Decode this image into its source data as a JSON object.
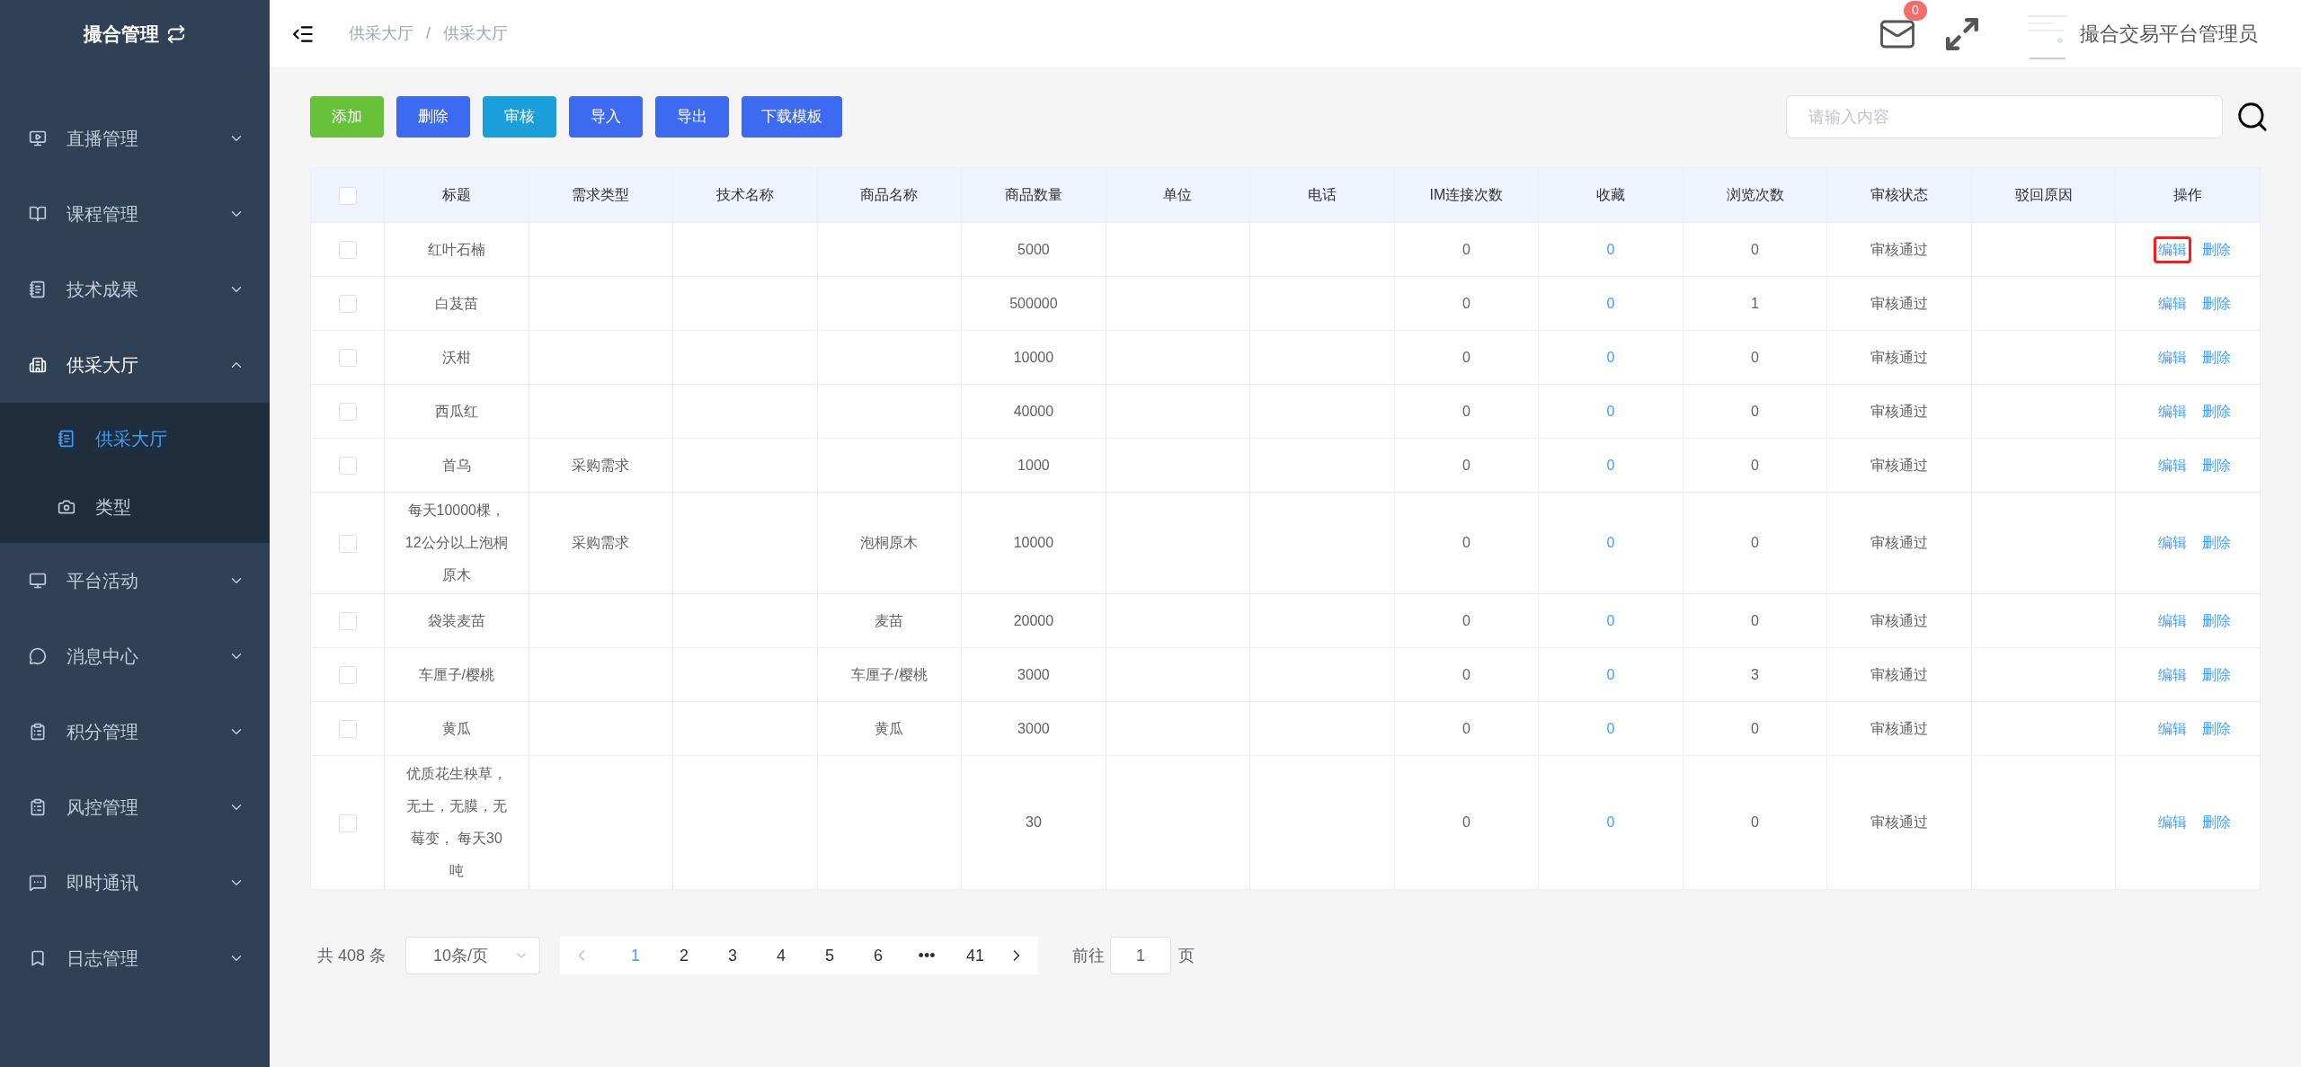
{
  "sidebar": {
    "title": "撮合管理",
    "items": [
      {
        "label": "直播管理",
        "expanded": false
      },
      {
        "label": "课程管理",
        "expanded": false
      },
      {
        "label": "技术成果",
        "expanded": false
      },
      {
        "label": "供采大厅",
        "expanded": true,
        "children": [
          {
            "label": "供采大厅",
            "selected": true
          },
          {
            "label": "类型",
            "selected": false
          }
        ]
      },
      {
        "label": "平台活动",
        "expanded": false
      },
      {
        "label": "消息中心",
        "expanded": false
      },
      {
        "label": "积分管理",
        "expanded": false
      },
      {
        "label": "风控管理",
        "expanded": false
      },
      {
        "label": "即时通讯",
        "expanded": false
      },
      {
        "label": "日志管理",
        "expanded": false
      }
    ]
  },
  "header": {
    "breadcrumb": [
      "供采大厅",
      "供采大厅"
    ],
    "breadcrumb_separator": "/",
    "message_count": "0",
    "user_name": "撮合交易平台管理员"
  },
  "toolbar": {
    "buttons": [
      {
        "label": "添加",
        "kind": "success"
      },
      {
        "label": "删除",
        "kind": "primary"
      },
      {
        "label": "审核",
        "kind": "info"
      },
      {
        "label": "导入",
        "kind": "primary"
      },
      {
        "label": "导出",
        "kind": "primary"
      },
      {
        "label": "下载模板",
        "kind": "primary"
      }
    ],
    "search": {
      "placeholder": "请输入内容"
    }
  },
  "table": {
    "select_all_checked": false,
    "columns": [
      "标题",
      "需求类型",
      "技术名称",
      "商品名称",
      "商品数量",
      "单位",
      "电话",
      "IM连接次数",
      "收藏",
      "浏览次数",
      "审核状态",
      "驳回原因",
      "操作"
    ],
    "rows": [
      {
        "checked": false,
        "title": "红叶石楠",
        "quantity": "5000",
        "im_count": "0",
        "favorites": "0",
        "views": "0",
        "audit_status": "审核通过",
        "edit": "编辑",
        "delete": "删除",
        "highlighted": true
      },
      {
        "checked": false,
        "title": "白芨苗",
        "quantity": "500000",
        "im_count": "0",
        "favorites": "0",
        "views": "1",
        "audit_status": "审核通过",
        "edit": "编辑",
        "delete": "删除",
        "highlighted": false
      },
      {
        "checked": false,
        "title": "沃柑",
        "quantity": "10000",
        "im_count": "0",
        "favorites": "0",
        "views": "0",
        "audit_status": "审核通过",
        "edit": "编辑",
        "delete": "删除",
        "highlighted": false
      },
      {
        "checked": false,
        "title": "西瓜红",
        "quantity": "40000",
        "im_count": "0",
        "favorites": "0",
        "views": "0",
        "audit_status": "审核通过",
        "edit": "编辑",
        "delete": "删除",
        "highlighted": false
      },
      {
        "checked": false,
        "title": "首乌",
        "demand_type": "采购需求",
        "quantity": "1000",
        "im_count": "0",
        "favorites": "0",
        "views": "0",
        "audit_status": "审核通过",
        "edit": "编辑",
        "delete": "删除",
        "highlighted": false
      },
      {
        "checked": false,
        "title": "每天10000棵，12公分以上泡桐原木",
        "demand_type": "采购需求",
        "product_name": "泡桐原木",
        "quantity": "10000",
        "im_count": "0",
        "favorites": "0",
        "views": "0",
        "audit_status": "审核通过",
        "edit": "编辑",
        "delete": "删除",
        "highlighted": false
      },
      {
        "checked": false,
        "title": "袋装麦苗",
        "product_name": "麦苗",
        "quantity": "20000",
        "im_count": "0",
        "favorites": "0",
        "views": "0",
        "audit_status": "审核通过",
        "edit": "编辑",
        "delete": "删除",
        "highlighted": false
      },
      {
        "checked": false,
        "title": "车厘子/樱桃",
        "product_name": "车厘子/樱桃",
        "quantity": "3000",
        "im_count": "0",
        "favorites": "0",
        "views": "3",
        "audit_status": "审核通过",
        "edit": "编辑",
        "delete": "删除",
        "highlighted": false
      },
      {
        "checked": false,
        "title": "黄瓜",
        "product_name": "黄瓜",
        "quantity": "3000",
        "im_count": "0",
        "favorites": "0",
        "views": "0",
        "audit_status": "审核通过",
        "edit": "编辑",
        "delete": "删除",
        "highlighted": false
      },
      {
        "checked": false,
        "title": "优质花生秧草，无土，无膜，无莓变， 每天30吨",
        "quantity": "30",
        "im_count": "0",
        "favorites": "0",
        "views": "0",
        "audit_status": "审核通过",
        "edit": "编辑",
        "delete": "删除",
        "highlighted": false
      }
    ]
  },
  "pagination": {
    "total": "共 408 条",
    "page_size": "10条/页",
    "pages": [
      {
        "label": "1",
        "selected": true
      },
      {
        "label": "2",
        "selected": false
      },
      {
        "label": "3",
        "selected": false
      },
      {
        "label": "4",
        "selected": false
      },
      {
        "label": "5",
        "selected": false
      },
      {
        "label": "6",
        "selected": false
      },
      {
        "label": "•••",
        "selected": false
      },
      {
        "label": "41",
        "selected": false
      }
    ],
    "goto_label": "前往",
    "goto_value": "1",
    "page_suffix": "页"
  }
}
